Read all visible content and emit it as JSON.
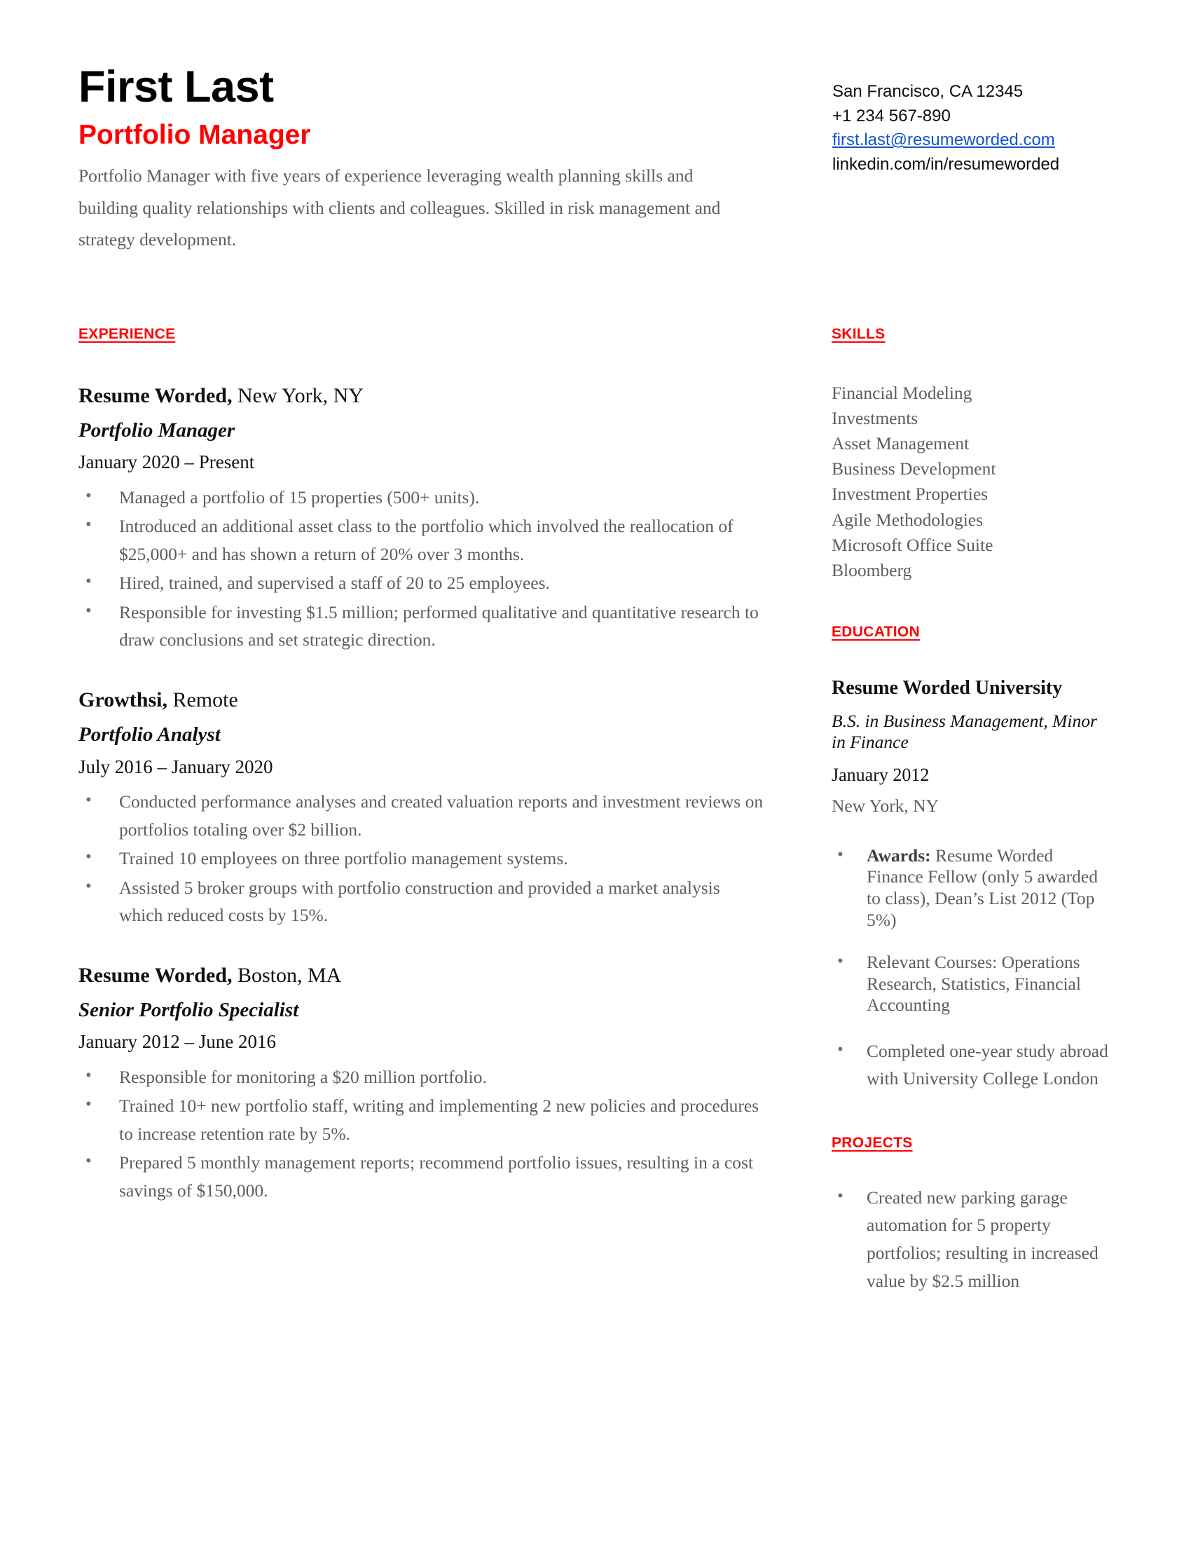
{
  "theme": {
    "accent_color": "#ff0000",
    "link_color": "#1155cc",
    "body_text_color": "#5d5d5d",
    "heading_text_color": "#000000",
    "background": "#ffffff"
  },
  "header": {
    "name": "First Last",
    "job_title": "Portfolio Manager",
    "summary": "Portfolio Manager with five years of experience leveraging wealth planning skills and building quality relationships with clients and colleagues. Skilled in risk management and strategy development.",
    "contact": {
      "location": "San Francisco, CA 12345",
      "phone": "+1 234 567-890",
      "email": "first.last@resumeworded.com",
      "linkedin": "linkedin.com/in/resumeworded"
    }
  },
  "experience": {
    "heading": "EXPERIENCE",
    "jobs": [
      {
        "company": "Resume Worded,",
        "location": " New York, NY",
        "role": "Portfolio Manager",
        "dates": "January 2020 – Present",
        "bullets": [
          "Managed a portfolio of 15 properties (500+ units).",
          "Introduced an additional asset class to the portfolio which involved the reallocation of $25,000+ and has shown a return of 20% over 3 months.",
          "Hired, trained, and supervised a staff of 20 to 25 employees.",
          "Responsible for investing $1.5 million; performed qualitative and quantitative research to draw conclusions and set strategic direction."
        ]
      },
      {
        "company": "Growthsi,",
        "location": " Remote",
        "role": "Portfolio Analyst",
        "dates": "July 2016 – January 2020",
        "bullets": [
          "Conducted performance analyses and created valuation reports and investment reviews on portfolios totaling over $2 billion.",
          "Trained 10 employees on three portfolio management systems.",
          "Assisted 5 broker groups with portfolio construction and provided a market analysis which reduced costs by 15%."
        ]
      },
      {
        "company": "Resume Worded,",
        "location": " Boston, MA",
        "role": "Senior Portfolio Specialist",
        "dates": "January 2012 – June 2016",
        "bullets": [
          "Responsible for monitoring a $20 million portfolio.",
          "Trained 10+ new portfolio staff, writing and implementing 2 new policies and procedures to increase retention rate by 5%.",
          "Prepared 5 monthly management reports; recommend portfolio issues, resulting in a cost savings of $150,000."
        ]
      }
    ]
  },
  "skills": {
    "heading": "SKILLS",
    "items": [
      "Financial Modeling",
      "Investments",
      "Asset Management",
      "Business Development",
      "Investment Properties",
      "Agile Methodologies",
      "Microsoft Office Suite",
      "Bloomberg"
    ]
  },
  "education": {
    "heading": "EDUCATION",
    "school": "Resume Worded University",
    "degree": "B.S. in Business Management, Minor in Finance",
    "date": "January 2012",
    "location": "New York, NY",
    "bullets": [
      {
        "label": "Awards:",
        "text": " Resume Worded Finance Fellow (only 5 awarded to class), Dean’s List 2012 (Top 5%)"
      },
      {
        "label": "",
        "text": "Relevant Courses: Operations Research, Statistics, Financial Accounting"
      },
      {
        "label": "",
        "text": "Completed one-year study abroad with University College London"
      }
    ]
  },
  "projects": {
    "heading": "PROJECTS",
    "bullets": [
      "Created new parking garage automation for 5 property portfolios; resulting in increased value by $2.5 million"
    ]
  }
}
